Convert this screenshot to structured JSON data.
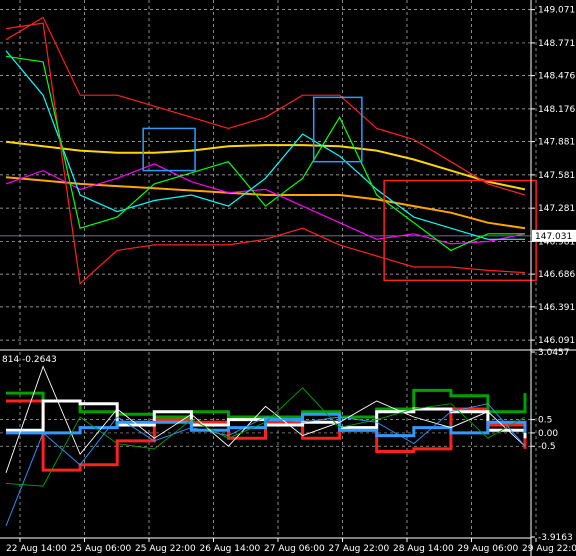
{
  "chart_data": [
    {
      "type": "line",
      "title": "",
      "price_axis": {
        "ticks": [
          "149.071",
          "148.771",
          "148.476",
          "148.176",
          "147.881",
          "147.581",
          "147.281",
          "146.981",
          "146.686",
          "146.391",
          "146.091"
        ],
        "tick_values": [
          149.071,
          148.771,
          148.476,
          148.176,
          147.881,
          147.581,
          147.281,
          146.981,
          146.686,
          146.391,
          146.091
        ],
        "ylim": [
          146.02,
          149.14
        ],
        "current_price_label": "147.031",
        "current_price": 147.031
      },
      "time_axis": {
        "ticks": [
          "22 Aug 14:00",
          "25 Aug 06:00",
          "25 Aug 22:00",
          "26 Aug 14:00",
          "27 Aug 06:00",
          "27 Aug 22:00",
          "28 Aug 14:00",
          "29 Aug 06:00",
          "29 Aug 22:00"
        ]
      },
      "grid": true,
      "series": [
        {
          "color": "#ffd700",
          "values": [
            147.88,
            147.84,
            147.8,
            147.78,
            147.78,
            147.8,
            147.84,
            147.85,
            147.85,
            147.84,
            147.8,
            147.72,
            147.62,
            147.52,
            147.45
          ]
        },
        {
          "color": "#ffa500",
          "values": [
            147.56,
            147.53,
            147.5,
            147.48,
            147.46,
            147.44,
            147.42,
            147.4,
            147.4,
            147.4,
            147.36,
            147.3,
            147.24,
            147.15,
            147.1
          ]
        },
        {
          "color": "#ff00ff",
          "values": [
            147.5,
            147.62,
            147.45,
            147.55,
            147.68,
            147.52,
            147.42,
            147.45,
            147.3,
            147.15,
            147.0,
            147.05,
            146.96,
            146.98,
            147.05
          ]
        },
        {
          "color": "#00ffff",
          "values": [
            148.7,
            148.3,
            147.4,
            147.25,
            147.35,
            147.4,
            147.3,
            147.55,
            147.95,
            147.75,
            147.45,
            147.2,
            147.1,
            147.0,
            147.0
          ]
        },
        {
          "color": "#ff2020",
          "values": [
            148.9,
            148.95,
            146.6,
            146.9,
            146.95,
            146.95,
            146.95,
            147.0,
            147.1,
            146.95,
            146.85,
            146.75,
            146.75,
            146.72,
            146.7
          ]
        },
        {
          "color": "#ff2020",
          "values": [
            148.8,
            149.0,
            148.3,
            148.3,
            148.2,
            148.1,
            148.0,
            148.1,
            148.3,
            148.3,
            148.0,
            147.9,
            147.7,
            147.5,
            147.4
          ]
        },
        {
          "color": "#00ff00",
          "values": [
            148.65,
            148.6,
            147.1,
            147.2,
            147.5,
            147.6,
            147.7,
            147.3,
            147.55,
            148.1,
            147.4,
            147.15,
            146.9,
            147.05,
            147.05
          ]
        }
      ],
      "markers": [
        {
          "kind": "box",
          "color": "#3399ff",
          "x": [
            3.7,
            5.1
          ],
          "y": [
            147.62,
            148.0
          ]
        },
        {
          "kind": "box",
          "color": "#3399ff",
          "x": [
            8.3,
            9.6
          ],
          "y": [
            147.7,
            148.28
          ]
        },
        {
          "kind": "box",
          "color": "#ff2020",
          "x": [
            10.2,
            14.3
          ],
          "y": [
            146.63,
            147.53
          ]
        }
      ]
    },
    {
      "type": "line",
      "title": "",
      "header_label": "814 -0.2643",
      "axis": {
        "ticks": [
          "3.0457",
          "0.5",
          "0.00",
          "-0.5",
          "-3.9163"
        ],
        "tick_values": [
          3.0457,
          0.5,
          0.0,
          -0.5,
          -3.9163
        ],
        "ylim": [
          -3.9163,
          3.0457
        ]
      },
      "hlines": [
        0.5,
        0.0,
        -0.5
      ],
      "series": [
        {
          "color": "#ff2020",
          "values": [
            1.2,
            -1.4,
            -1.2,
            -0.3,
            0.5,
            0.4,
            -0.2,
            0.4,
            -0.2,
            0.1,
            -0.7,
            -0.6,
            0.9,
            0.3,
            -0.6
          ]
        },
        {
          "color": "#00a000",
          "values": [
            1.5,
            1.2,
            0.8,
            0.7,
            0.6,
            0.8,
            0.6,
            0.6,
            0.8,
            0.6,
            0.9,
            1.6,
            1.4,
            0.8,
            1.5
          ]
        },
        {
          "color": "#ffffff",
          "values": [
            0.1,
            1.2,
            1.1,
            0.3,
            0.8,
            0.3,
            0.5,
            0.3,
            0.4,
            0.2,
            0.8,
            0.9,
            0.8,
            0.1,
            -0.2
          ]
        },
        {
          "color": "#3399ff",
          "values": [
            0.0,
            0.0,
            0.2,
            0.4,
            0.4,
            0.1,
            0.2,
            0.5,
            0.7,
            0.1,
            -0.1,
            0.2,
            0.0,
            0.4,
            0.0
          ]
        },
        {
          "color": "#ffffff",
          "thin": true,
          "values": [
            -1.5,
            2.5,
            -0.8,
            0.9,
            -0.2,
            0.7,
            -0.5,
            1.0,
            -0.1,
            0.4,
            1.2,
            0.6,
            0.2,
            0.8,
            -0.5
          ]
        },
        {
          "color": "#00a000",
          "thin": true,
          "values": [
            -1.9,
            -2.0,
            0.6,
            -0.4,
            -0.6,
            0.5,
            -0.2,
            0.4,
            1.7,
            0.2,
            0.5,
            0.9,
            1.1,
            -0.2,
            0.6
          ]
        },
        {
          "color": "#3399ff",
          "thin": true,
          "values": [
            -3.5,
            0.0,
            -1.2,
            0.6,
            -0.3,
            0.2,
            -0.1,
            0.6,
            0.4,
            0.6,
            0.4,
            -0.4,
            0.8,
            1.1,
            -0.5
          ]
        }
      ]
    }
  ]
}
